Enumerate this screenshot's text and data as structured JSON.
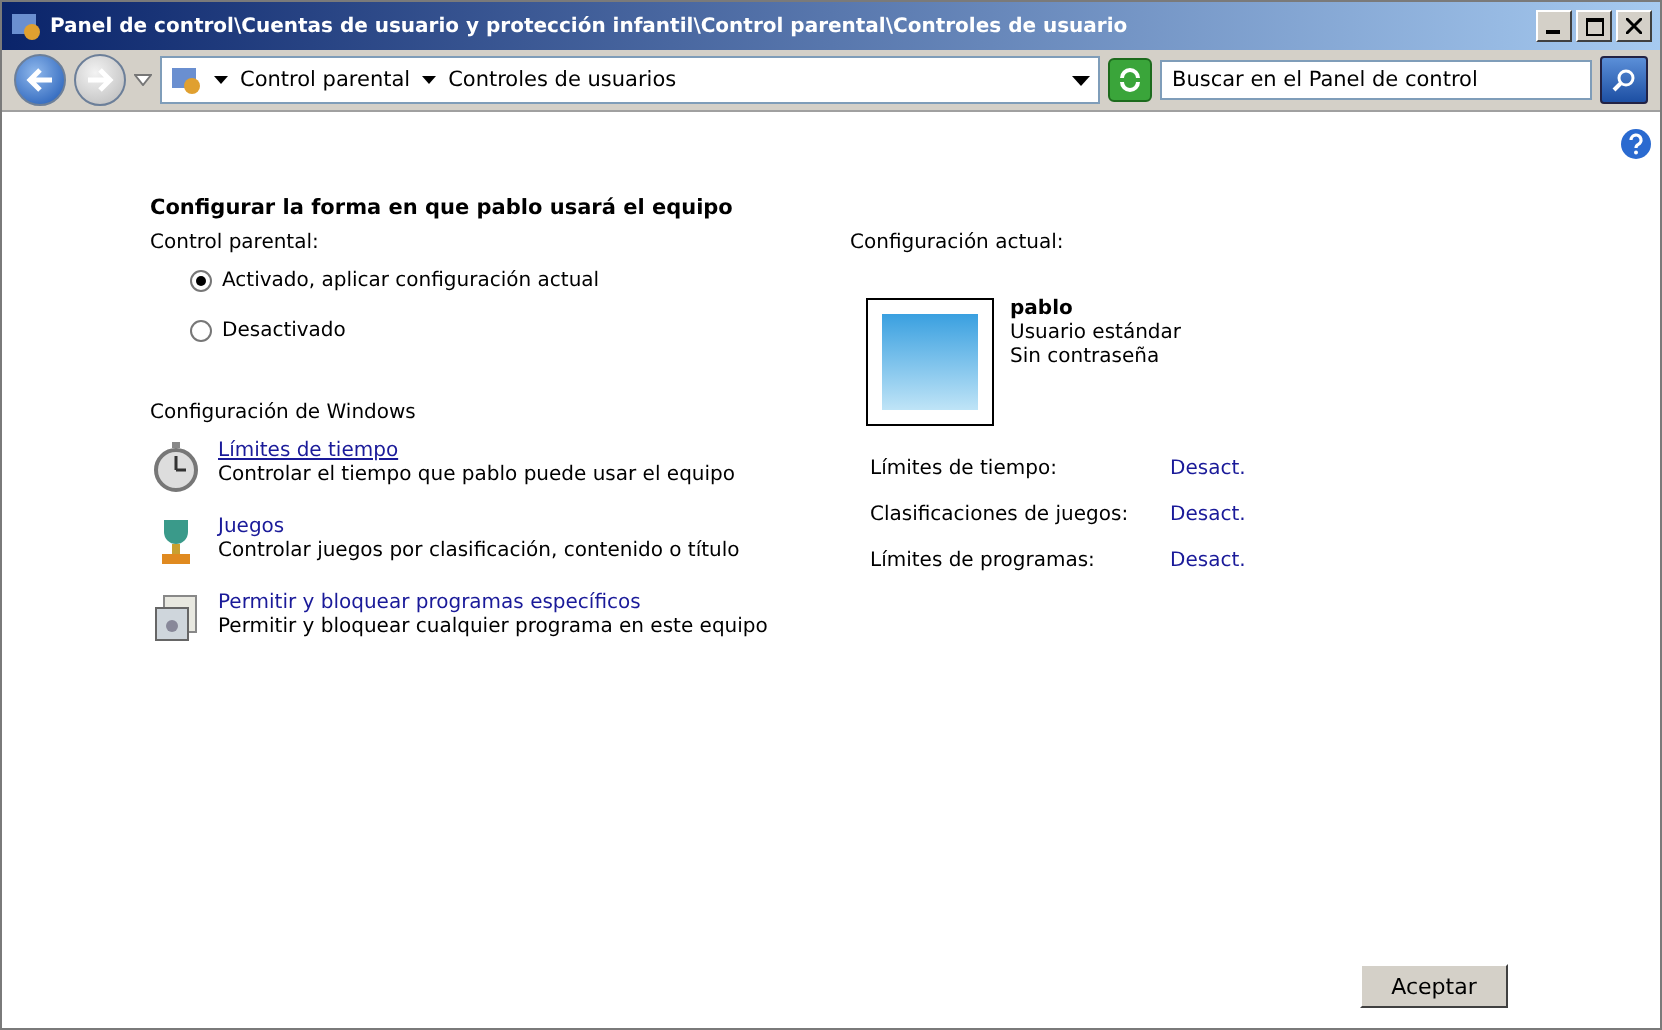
{
  "window": {
    "title": "Panel de control\\Cuentas de usuario y protección infantil\\Control parental\\Controles de usuario"
  },
  "address_bar": {
    "crumbs": [
      "Control parental",
      "Controles de usuarios"
    ]
  },
  "search": {
    "placeholder": "Buscar en el Panel de control"
  },
  "heading": "Configurar la forma en que pablo usará el equipo",
  "parental_control": {
    "label": "Control parental:",
    "options": [
      {
        "label": "Activado, aplicar configuración actual",
        "selected": true
      },
      {
        "label": "Desactivado",
        "selected": false
      }
    ]
  },
  "windows_settings": {
    "label": "Configuración de Windows",
    "items": [
      {
        "kind": "clock",
        "link": "Límites de tiempo",
        "description": "Controlar el tiempo que pablo puede usar el equipo"
      },
      {
        "kind": "trophy",
        "link": "Juegos",
        "description": "Controlar juegos por clasificación, contenido o título"
      },
      {
        "kind": "programs",
        "link": "Permitir y bloquear programas específicos",
        "description": "Permitir y bloquear cualquier programa en este equipo"
      }
    ]
  },
  "current_settings": {
    "label": "Configuración actual:",
    "user": {
      "name": "pablo",
      "type": "Usuario estándar",
      "password": "Sin contraseña"
    },
    "rows": [
      {
        "label": "Límites de tiempo:",
        "value": "Desact."
      },
      {
        "label": "Clasificaciones de juegos:",
        "value": "Desact."
      },
      {
        "label": "Límites de programas:",
        "value": "Desact."
      }
    ]
  },
  "buttons": [
    "Aceptar"
  ]
}
